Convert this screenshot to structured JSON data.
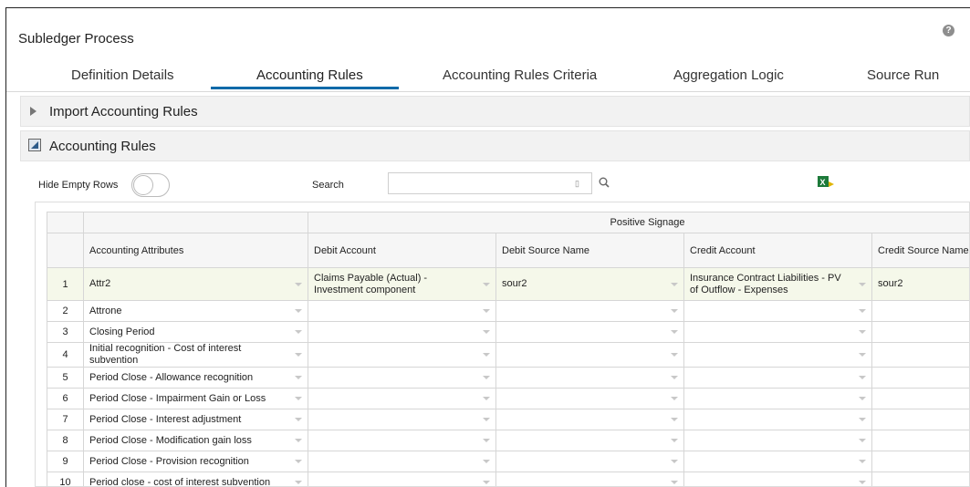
{
  "app": {
    "title": "Subledger Process",
    "help": "?"
  },
  "tabs": [
    {
      "label": "Definition Details"
    },
    {
      "label": "Accounting Rules"
    },
    {
      "label": "Accounting Rules Criteria"
    },
    {
      "label": "Aggregation Logic"
    },
    {
      "label": "Source Run"
    }
  ],
  "active_tab": "Accounting Rules",
  "sections": {
    "import": "Import Accounting Rules",
    "rules": "Accounting Rules"
  },
  "toolbar": {
    "hide_empty_rows": "Hide Empty Rows",
    "hide_empty_rows_on": false,
    "search_label": "Search",
    "search_value": "",
    "search_placeholder": ""
  },
  "grid": {
    "group_header": "Positive Signage",
    "columns": [
      "Accounting Attributes",
      "Debit Account",
      "Debit Source Name",
      "Credit Account",
      "Credit Source Name"
    ],
    "rows": [
      {
        "n": "1",
        "attr": "Attr2",
        "debit": "Claims Payable (Actual) - Investment component",
        "debit_src": "sour2",
        "credit": "Insurance Contract Liabilities - PV of Outflow - Expenses",
        "credit_src": "sour2"
      },
      {
        "n": "2",
        "attr": "Attrone",
        "debit": "",
        "debit_src": "",
        "credit": "",
        "credit_src": ""
      },
      {
        "n": "3",
        "attr": "Closing Period",
        "debit": "",
        "debit_src": "",
        "credit": "",
        "credit_src": ""
      },
      {
        "n": "4",
        "attr": "Initial recognition - Cost of interest subvention",
        "debit": "",
        "debit_src": "",
        "credit": "",
        "credit_src": ""
      },
      {
        "n": "5",
        "attr": "Period Close - Allowance recognition",
        "debit": "",
        "debit_src": "",
        "credit": "",
        "credit_src": ""
      },
      {
        "n": "6",
        "attr": "Period Close - Impairment Gain or Loss",
        "debit": "",
        "debit_src": "",
        "credit": "",
        "credit_src": ""
      },
      {
        "n": "7",
        "attr": "Period Close - Interest adjustment",
        "debit": "",
        "debit_src": "",
        "credit": "",
        "credit_src": ""
      },
      {
        "n": "8",
        "attr": "Period Close - Modification gain loss",
        "debit": "",
        "debit_src": "",
        "credit": "",
        "credit_src": ""
      },
      {
        "n": "9",
        "attr": "Period Close - Provision recognition",
        "debit": "",
        "debit_src": "",
        "credit": "",
        "credit_src": ""
      },
      {
        "n": "10",
        "attr": "Period close - cost of interest subvention",
        "debit": "",
        "debit_src": "",
        "credit": "",
        "credit_src": ""
      }
    ]
  },
  "colors": {
    "tab_underline": "#0f6aa9",
    "highlight_row": "#f5f8ea",
    "excel_green": "#1d7a3a"
  },
  "icons": {
    "help": "help-icon",
    "expand": "triangle-right-icon",
    "collapse": "collapse-icon",
    "search": "search-icon",
    "export": "excel-export-icon",
    "dropdown": "chevron-down-icon"
  }
}
